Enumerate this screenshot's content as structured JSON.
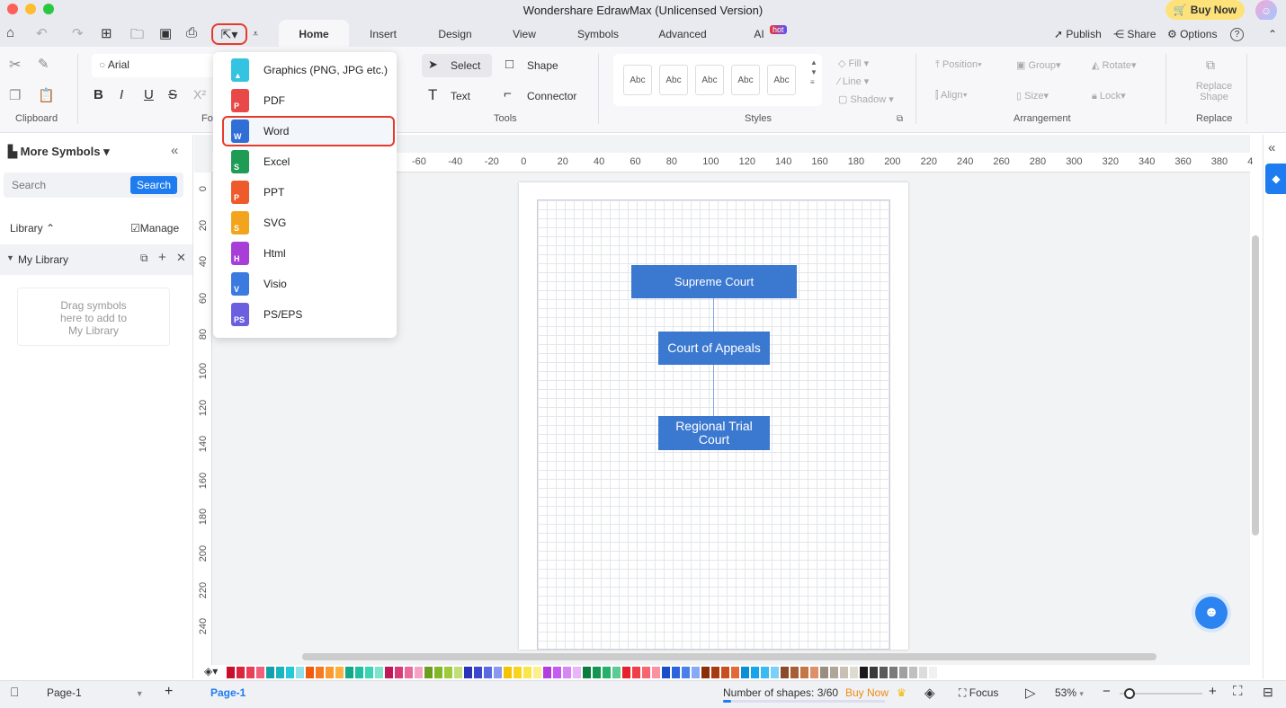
{
  "window": {
    "title": "Wondershare EdrawMax (Unlicensed Version)",
    "buy_now": "Buy Now",
    "avatar_icon": "user-avatar-icon"
  },
  "tabs": [
    {
      "label": "Home",
      "active": true
    },
    {
      "label": "Insert"
    },
    {
      "label": "Design"
    },
    {
      "label": "View"
    },
    {
      "label": "Symbols"
    },
    {
      "label": "Advanced"
    },
    {
      "label": "AI"
    }
  ],
  "ai_badge": "hot",
  "top_right": {
    "publish": "Publish",
    "share": "Share",
    "options": "Options",
    "help": "?"
  },
  "ribbon": {
    "clipboard": "Clipboard",
    "font_group": "Fo",
    "font_name": "Arial",
    "select": "Select",
    "shape": "Shape",
    "text": "Text",
    "connector": "Connector",
    "tools": "Tools",
    "style_samples": [
      "Abc",
      "Abc",
      "Abc",
      "Abc",
      "Abc"
    ],
    "styles": "Styles",
    "fill": "Fill",
    "line": "Line",
    "shadow": "Shadow",
    "position": "Position",
    "group": "Group",
    "rotate": "Rotate",
    "align": "Align",
    "size": "Size",
    "lock": "Lock",
    "arrangement": "Arrangement",
    "replace_shape": "Replace Shape",
    "replace": "Replace"
  },
  "export_menu": {
    "items": [
      {
        "label": "Graphics (PNG, JPG etc.)",
        "color": "#34c3e0",
        "letter": ""
      },
      {
        "label": "PDF",
        "color": "#e94848",
        "letter": "P"
      },
      {
        "label": "Word",
        "color": "#2f6fd6",
        "letter": "W",
        "highlighted": true
      },
      {
        "label": "Excel",
        "color": "#1e9b55",
        "letter": "S"
      },
      {
        "label": "PPT",
        "color": "#ef5a2a",
        "letter": "P"
      },
      {
        "label": "SVG",
        "color": "#f2a51c",
        "letter": "S"
      },
      {
        "label": "Html",
        "color": "#a73ed8",
        "letter": "H"
      },
      {
        "label": "Visio",
        "color": "#3b7be0",
        "letter": "V"
      },
      {
        "label": "PS/EPS",
        "color": "#6b5fe0",
        "letter": "PS"
      }
    ]
  },
  "left_panel": {
    "title": "More Symbols",
    "search_placeholder": "Search",
    "search_button": "Search",
    "library": "Library",
    "manage": "Manage",
    "my_library": "My Library",
    "drop_hint": "Drag symbols here to add to My Library"
  },
  "ruler": {
    "top": [
      "-60",
      "-40",
      "-20",
      "0",
      "20",
      "40",
      "60",
      "80",
      "100",
      "120",
      "140",
      "160",
      "180",
      "200",
      "220",
      "240",
      "260",
      "280",
      "300",
      "320",
      "340",
      "360",
      "380",
      "4"
    ],
    "left": [
      "0",
      "20",
      "40",
      "60",
      "80",
      "100",
      "120",
      "140",
      "160",
      "180",
      "200",
      "220",
      "240"
    ]
  },
  "diagram": {
    "nodes": [
      "Supreme Court",
      "Court of Appeals",
      "Regional Trial Court"
    ],
    "fill": "#3b78d0"
  },
  "palette": [
    "#c8102e",
    "#d9263d",
    "#e8405a",
    "#f0607a",
    "#14a0a8",
    "#1bb5c0",
    "#24c8d8",
    "#8ee0ea",
    "#f25a0f",
    "#f57a20",
    "#f89a30",
    "#fbb040",
    "#12a88a",
    "#1fbf9f",
    "#3dd4b4",
    "#7de3cc",
    "#c2185b",
    "#d83b7a",
    "#ea6a9c",
    "#f5a3c4",
    "#6b9e1f",
    "#82b827",
    "#9ccc3c",
    "#c0de7a",
    "#2a34b8",
    "#3a48d0",
    "#5a6ae0",
    "#8c98ee",
    "#f5c400",
    "#f8d420",
    "#fae54a",
    "#fcf08c",
    "#b33ee0",
    "#c65cf0",
    "#d986f5",
    "#e8b5fa",
    "#0a7d3c",
    "#129650",
    "#24b068",
    "#5ccc92",
    "#e8202a",
    "#ef3f48",
    "#f56670",
    "#f993a0",
    "#1a4ec8",
    "#2c64dc",
    "#4a80ec",
    "#86aaf5",
    "#8b2e08",
    "#a83a10",
    "#c84e20",
    "#e06a38",
    "#0a8ed8",
    "#18a4e8",
    "#3cbaf2",
    "#7ad0f8",
    "#8c4a26",
    "#a85e34",
    "#c47648",
    "#e09068",
    "#9a8e80",
    "#b0a698",
    "#c8c0b4",
    "#e0dbd2",
    "#1a1a1a",
    "#3a3a3a",
    "#5a5a5a",
    "#7a7a7a",
    "#a0a0a0",
    "#c0c0c0",
    "#dcdcdc",
    "#f0f0f0"
  ],
  "status": {
    "page_select": "Page-1",
    "page_tab": "Page-1",
    "shapes": "Number of shapes: 3/60",
    "buy_now": "Buy Now",
    "focus": "Focus",
    "zoom": "53%",
    "zoom_level": 0.53
  }
}
